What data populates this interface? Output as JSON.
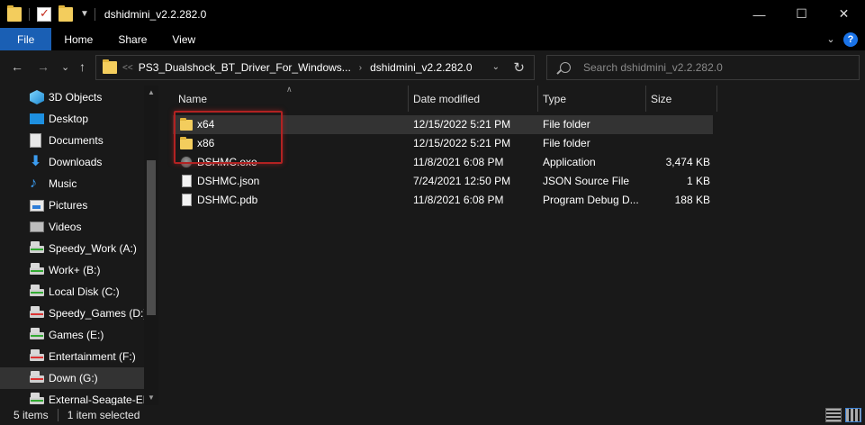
{
  "window": {
    "title": "dshidmini_v2.2.282.0",
    "controls": {
      "minimize": "—",
      "maximize": "☐",
      "close": "✕"
    }
  },
  "ribbon": {
    "tabs": [
      "File",
      "Home",
      "Share",
      "View"
    ],
    "expand_glyph": "⌄",
    "help_glyph": "?"
  },
  "nav": {
    "back": "←",
    "forward": "→",
    "recent": "⌄",
    "up": "↑"
  },
  "address": {
    "overflow_glyph": "<<",
    "crumbs": [
      "PS3_Dualshock_BT_Driver_For_Windows...",
      "dshidmini_v2.2.282.0"
    ],
    "separator": "›",
    "dropdown_glyph": "⌄",
    "refresh_glyph": "↻"
  },
  "search": {
    "placeholder": "Search dshidmini_v2.2.282.0"
  },
  "sidebar": {
    "items": [
      {
        "label": "3D Objects",
        "icon": "3d-objects-icon"
      },
      {
        "label": "Desktop",
        "icon": "desktop-icon"
      },
      {
        "label": "Documents",
        "icon": "documents-icon"
      },
      {
        "label": "Downloads",
        "icon": "downloads-icon"
      },
      {
        "label": "Music",
        "icon": "music-icon"
      },
      {
        "label": "Pictures",
        "icon": "pictures-icon"
      },
      {
        "label": "Videos",
        "icon": "videos-icon"
      },
      {
        "label": "Speedy_Work (A:)",
        "icon": "drive-icon"
      },
      {
        "label": "Work+ (B:)",
        "icon": "drive-icon"
      },
      {
        "label": "Local Disk (C:)",
        "icon": "drive-icon"
      },
      {
        "label": "Speedy_Games (D:)",
        "icon": "drive-icon"
      },
      {
        "label": "Games (E:)",
        "icon": "drive-icon"
      },
      {
        "label": "Entertainment (F:)",
        "icon": "drive-icon"
      },
      {
        "label": "Down (G:)",
        "icon": "drive-icon"
      },
      {
        "label": "External-Seagate-EM",
        "icon": "drive-icon"
      }
    ],
    "selected_index": 13
  },
  "columns": {
    "name": "Name",
    "date": "Date modified",
    "type": "Type",
    "size": "Size"
  },
  "files": [
    {
      "name": "x64",
      "date": "12/15/2022 5:21 PM",
      "type": "File folder",
      "size": "",
      "icon": "folder-icon"
    },
    {
      "name": "x86",
      "date": "12/15/2022 5:21 PM",
      "type": "File folder",
      "size": "",
      "icon": "folder-icon"
    },
    {
      "name": "DSHMC.exe",
      "date": "11/8/2021 6:08 PM",
      "type": "Application",
      "size": "3,474 KB",
      "icon": "application-icon"
    },
    {
      "name": "DSHMC.json",
      "date": "7/24/2021 12:50 PM",
      "type": "JSON Source File",
      "size": "1 KB",
      "icon": "json-file-icon"
    },
    {
      "name": "DSHMC.pdb",
      "date": "11/8/2021 6:08 PM",
      "type": "Program Debug D...",
      "size": "188 KB",
      "icon": "pdb-file-icon"
    }
  ],
  "selected_file_index": 0,
  "status": {
    "count": "5 items",
    "selection": "1 item selected"
  },
  "colors": {
    "accent": "#1a5fb4",
    "highlight_box": "#b22222",
    "background": "#191919"
  }
}
